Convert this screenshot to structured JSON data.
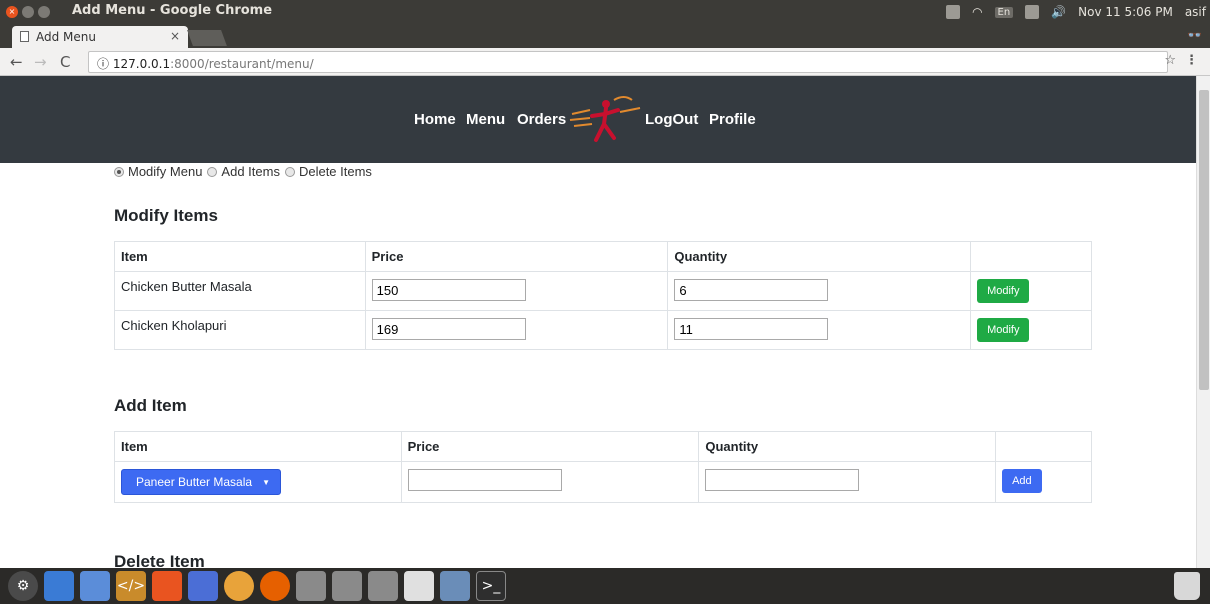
{
  "window": {
    "title": "Add Menu - Google Chrome",
    "tray": {
      "lang": "En",
      "datetime": "Nov 11  5:06 PM",
      "user": "asif"
    }
  },
  "browser": {
    "tab_title": "Add Menu",
    "tab_close": "×",
    "url_host": "127.0.0.1",
    "url_path": ":8000/restaurant/menu/",
    "info_icon": "ⓘ"
  },
  "site_nav": {
    "home": "Home",
    "menu": "Menu",
    "orders": "Orders",
    "logout": "LogOut",
    "profile": "Profile"
  },
  "mode_radios": [
    {
      "label": "Modify Menu",
      "checked": true
    },
    {
      "label": "Add Items",
      "checked": false
    },
    {
      "label": "Delete Items",
      "checked": false
    }
  ],
  "modify": {
    "heading": "Modify Items",
    "headers": [
      "Item",
      "Price",
      "Quantity",
      ""
    ],
    "rows": [
      {
        "item": "Chicken Butter Masala",
        "price": "150",
        "quantity": "6",
        "button": "Modify"
      },
      {
        "item": "Chicken Kholapuri",
        "price": "169",
        "quantity": "11",
        "button": "Modify"
      }
    ]
  },
  "add": {
    "heading": "Add Item",
    "headers": [
      "Item",
      "Price",
      "Quantity",
      ""
    ],
    "selected_item": "Paneer Butter Masala",
    "price": "",
    "quantity": "",
    "button": "Add"
  },
  "delete": {
    "heading": "Delete Item"
  },
  "colors": {
    "navbar": "#343a40",
    "modify_button": "#1faa45",
    "add_button": "#3d6af2",
    "select": "#3d6af2"
  },
  "dock_icons": [
    "system-settings-icon",
    "files-icon",
    "editor-icon",
    "code-icon",
    "software-center-icon",
    "display-icon",
    "chrome-icon",
    "firefox-icon",
    "drive-icon",
    "drive-icon",
    "drive-icon",
    "text-editor-icon",
    "screenshot-icon",
    "terminal-icon",
    "trash-icon"
  ]
}
